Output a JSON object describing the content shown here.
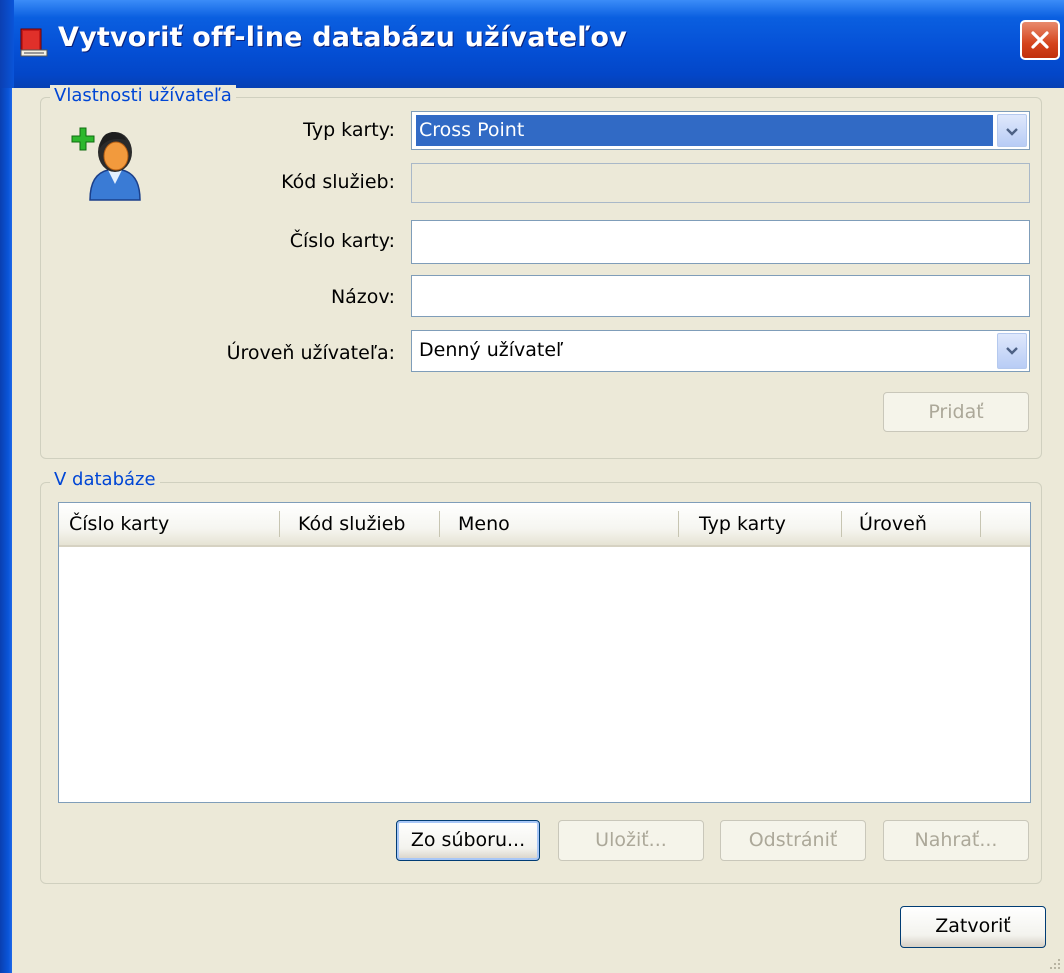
{
  "window": {
    "title": "Vytvoriť off-line databázu užívateľov",
    "app_icon": "red-book-icon",
    "close_icon": "close-icon"
  },
  "user_props": {
    "legend": "Vlastnosti užívateľa",
    "icon": "add-user-icon",
    "card_type_label": "Typ karty:",
    "card_type_value": "Cross Point",
    "service_code_label": "Kód služieb:",
    "service_code_value": "",
    "card_number_label": "Číslo karty:",
    "card_number_value": "",
    "name_label": "Názov:",
    "name_value": "",
    "user_level_label": "Úroveň užívateľa:",
    "user_level_value": "Denný užívateľ",
    "add_button": "Pridať"
  },
  "database": {
    "legend": "V databáze",
    "columns": [
      "Číslo karty",
      "Kód služieb",
      "Meno",
      "Typ karty",
      "Úroveň"
    ],
    "rows": [],
    "from_file_button": "Zo súboru...",
    "save_button": "Uložiť...",
    "remove_button": "Odstrániť",
    "upload_button": "Nahrať..."
  },
  "close_button": "Zatvoriť",
  "colors": {
    "titlebar": "#0550d6",
    "dialog_bg": "#ece9d8",
    "legend_text": "#0046d5",
    "selection": "#316ac5"
  }
}
